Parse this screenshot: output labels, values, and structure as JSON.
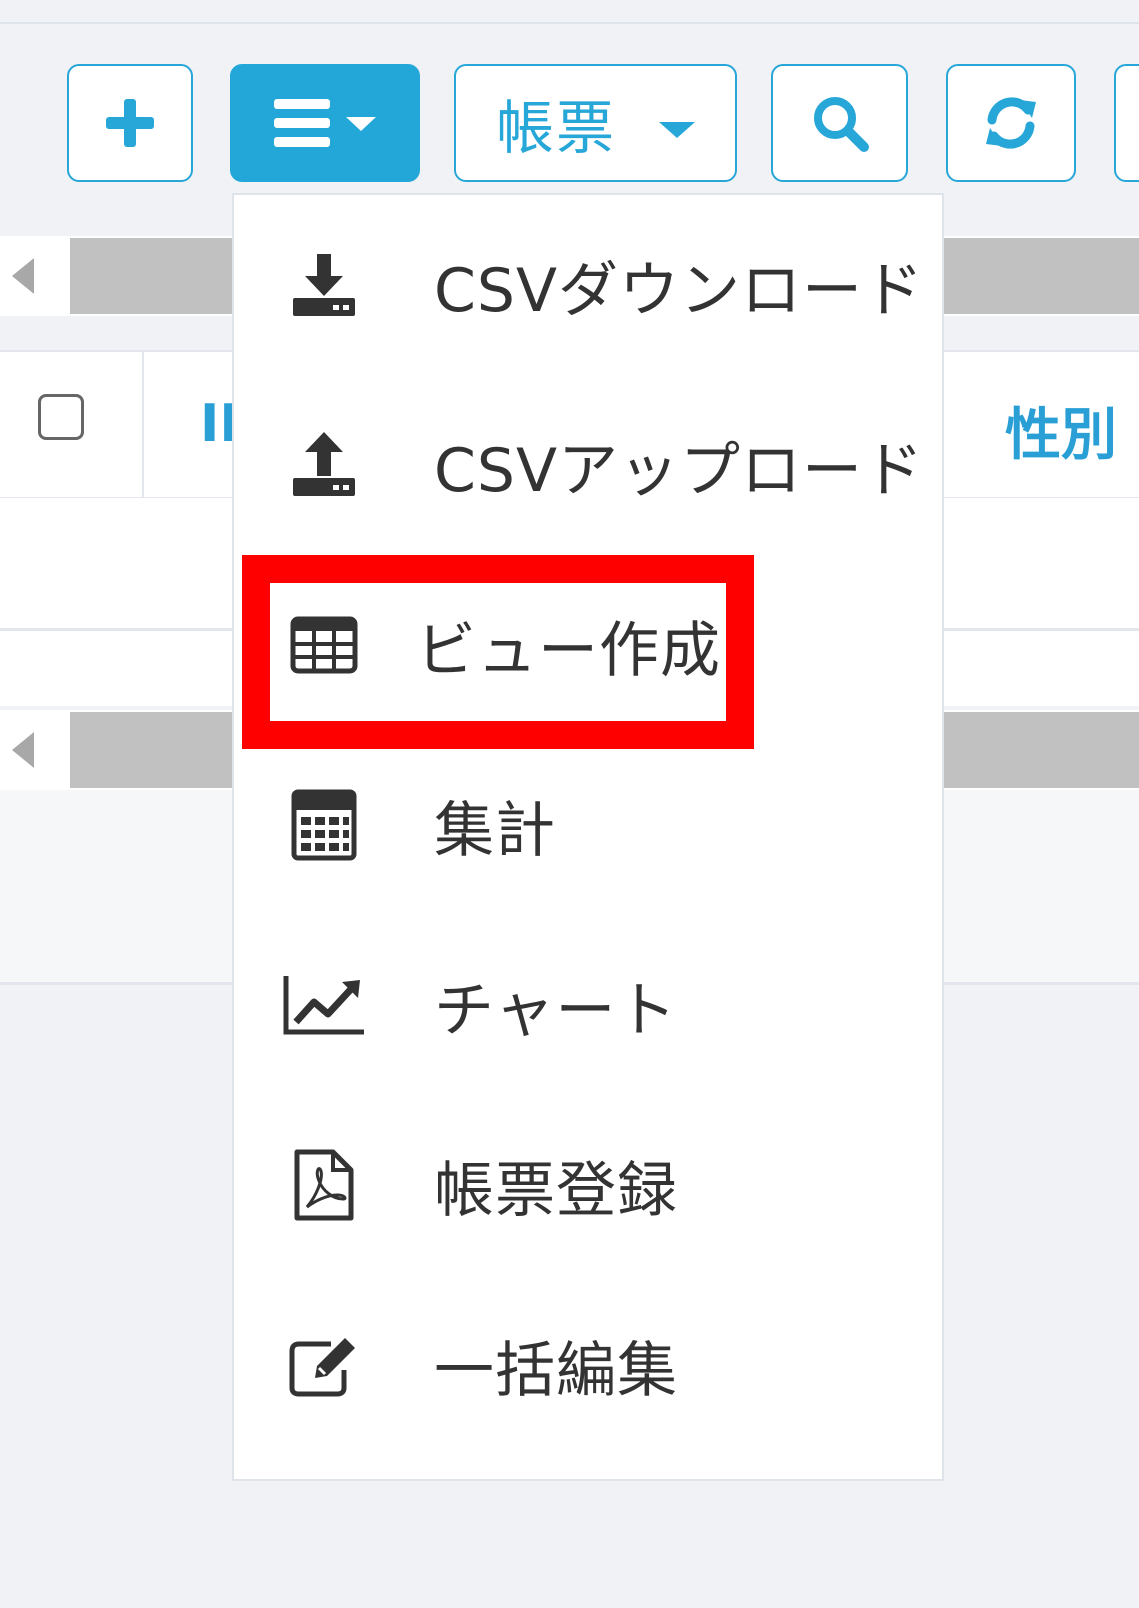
{
  "toolbar": {
    "add_icon": "plus-icon",
    "menu_icon": "bars-icon",
    "report_label": "帳票",
    "search_icon": "search-icon",
    "refresh_icon": "refresh-icon"
  },
  "table": {
    "id_header": "II",
    "gender_header": "性別"
  },
  "menu": {
    "items": [
      {
        "label": "CSVダウンロード",
        "icon": "download-icon"
      },
      {
        "label": "CSVアップロード",
        "icon": "upload-icon"
      },
      {
        "label": "ビュー作成",
        "icon": "table-icon"
      },
      {
        "label": "集計",
        "icon": "calculator-icon"
      },
      {
        "label": "チャート",
        "icon": "line-chart-icon"
      },
      {
        "label": "帳票登録",
        "icon": "file-pdf-icon"
      },
      {
        "label": "一括編集",
        "icon": "edit-icon"
      }
    ]
  },
  "colors": {
    "accent": "#27a6d8",
    "highlight": "#ff0000",
    "menu_text": "#333333"
  }
}
